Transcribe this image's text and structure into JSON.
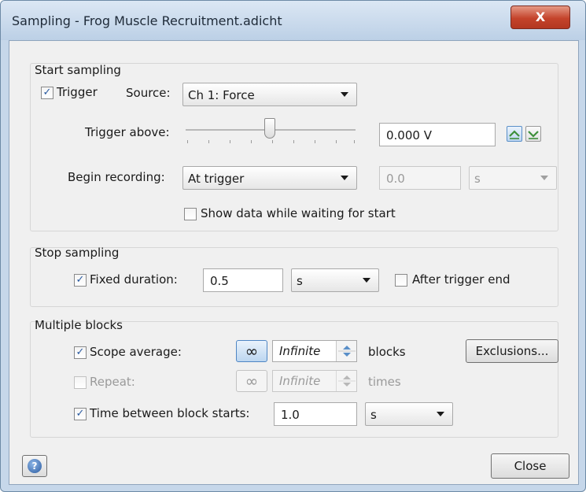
{
  "window": {
    "title": "Sampling - Frog Muscle Recruitment.adicht",
    "close_glyph": "X"
  },
  "start": {
    "heading": "Start sampling",
    "trigger_label": "Trigger",
    "trigger_checked": true,
    "source_label": "Source:",
    "source_value": "Ch 1: Force",
    "trigger_above_label": "Trigger above:",
    "trigger_level": "0.000 V",
    "slider_position": 0.5,
    "begin_label": "Begin recording:",
    "begin_value": "At trigger",
    "delay_value": "0.0",
    "delay_unit": "s",
    "show_data_label": "Show data while waiting for start",
    "show_data_checked": false
  },
  "stop": {
    "heading": "Stop sampling",
    "fixed_label": "Fixed duration:",
    "fixed_checked": true,
    "duration_value": "0.5",
    "duration_unit": "s",
    "after_label": "After trigger end",
    "after_checked": false
  },
  "blocks": {
    "heading": "Multiple blocks",
    "scope_label": "Scope average:",
    "scope_checked": true,
    "scope_value": "Infinite",
    "scope_suffix": "blocks",
    "exclusions_label": "Exclusions...",
    "repeat_label": "Repeat:",
    "repeat_checked": false,
    "repeat_value": "Infinite",
    "repeat_suffix": "times",
    "time_label": "Time between block starts:",
    "time_checked": true,
    "time_value": "1.0",
    "time_unit": "s",
    "infinity_glyph": "∞"
  },
  "footer": {
    "help_glyph": "?",
    "close_label": "Close"
  },
  "colors": {
    "title_bar": "#c6d7ea",
    "close_red": "#c4432b",
    "check_blue": "#2a5aa0",
    "trigger_icon_green": "#3d8f3a"
  }
}
